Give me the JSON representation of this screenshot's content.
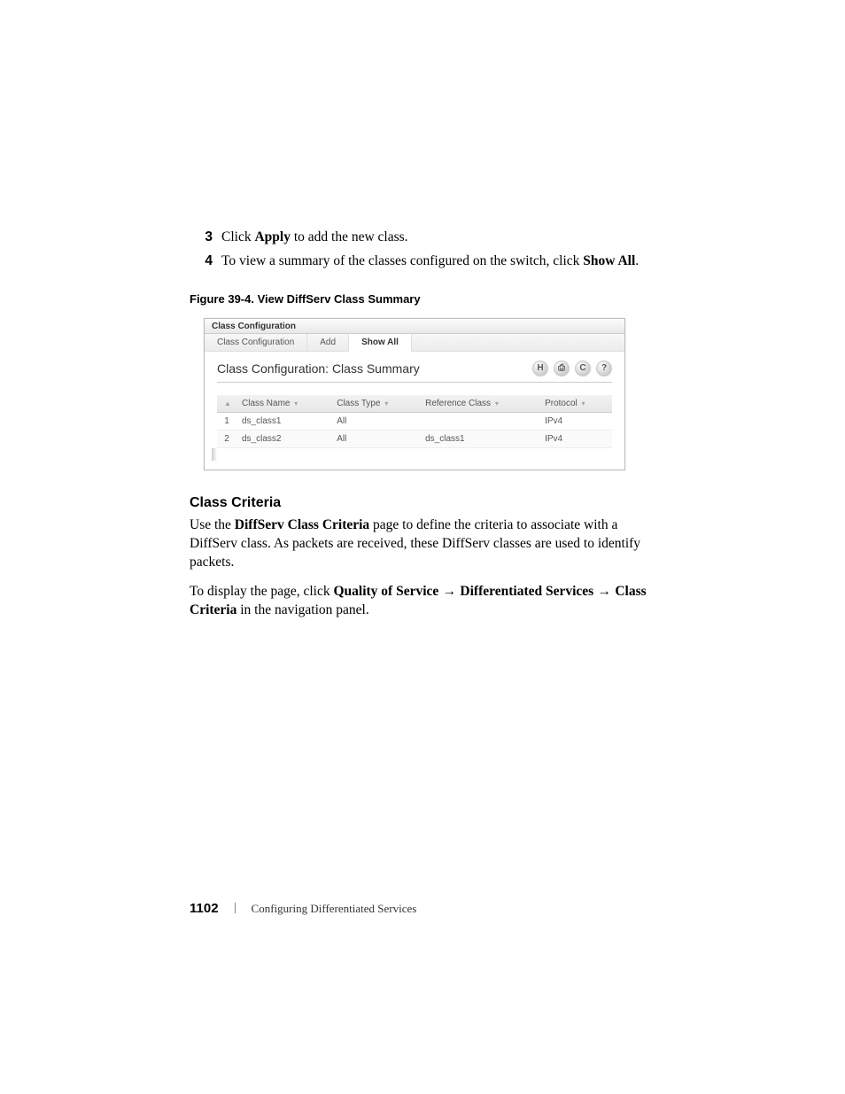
{
  "steps": [
    {
      "num": "3",
      "parts": [
        "Click ",
        "Apply",
        " to add the new class."
      ]
    },
    {
      "num": "4",
      "parts": [
        "To view a summary of the classes configured on the switch, click ",
        "Show All",
        "."
      ]
    }
  ],
  "figure_caption": "Figure 39-4.    View DiffServ Class Summary",
  "screenshot": {
    "title": "Class Configuration",
    "tabs": [
      {
        "label": "Class Configuration",
        "active": false
      },
      {
        "label": "Add",
        "active": false
      },
      {
        "label": "Show All",
        "active": true
      }
    ],
    "heading": "Class Configuration: Class Summary",
    "icons": [
      "H",
      "⎙",
      "C",
      "?"
    ],
    "columns": [
      "",
      "Class Name",
      "Class Type",
      "Reference Class",
      "Protocol"
    ],
    "sort_icon": "▲",
    "rows": [
      {
        "idx": "1",
        "name": "ds_class1",
        "type": "All",
        "ref": "",
        "proto": "IPv4"
      },
      {
        "idx": "2",
        "name": "ds_class2",
        "type": "All",
        "ref": "ds_class1",
        "proto": "IPv4"
      }
    ]
  },
  "section": {
    "heading": "Class Criteria",
    "p1_parts": [
      "Use the ",
      "DiffServ Class Criteria",
      " page to define the criteria to associate with a DiffServ class. As packets are received, these DiffServ classes are used to identify packets."
    ],
    "p2_parts_a": "To display the page, click ",
    "p2_b": "Quality of Service",
    "p2_arrow": " → ",
    "p2_c": "Differentiated Services",
    "p2_d": "Class Criteria",
    "p2_tail": " in the navigation panel."
  },
  "footer": {
    "page": "1102",
    "title": "Configuring Differentiated Services"
  }
}
